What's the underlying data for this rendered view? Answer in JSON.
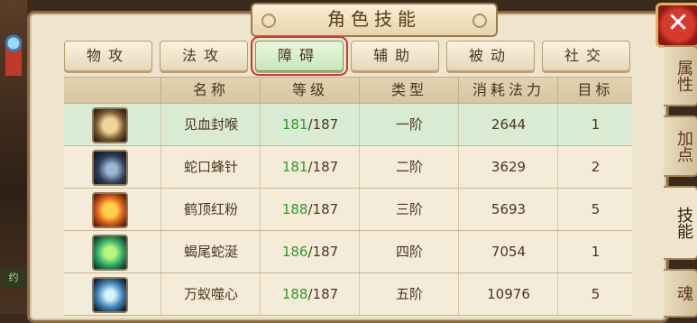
{
  "title": "角色技能",
  "close_symbol": "✕",
  "left_tag": "约",
  "tabs": [
    {
      "label": "物攻"
    },
    {
      "label": "法攻"
    },
    {
      "label": "障碍"
    },
    {
      "label": "辅助"
    },
    {
      "label": "被动"
    },
    {
      "label": "社交"
    }
  ],
  "active_tab": "障碍",
  "table": {
    "headers": [
      "",
      "名称",
      "等级",
      "类型",
      "消耗法力",
      "目标"
    ],
    "rows": [
      {
        "icon": "skill-icon-blood",
        "name": "见血封喉",
        "level_current": "181",
        "level_max": "/187",
        "type": "一阶",
        "mana": "2644",
        "target": "1",
        "selected": true
      },
      {
        "icon": "skill-icon-snake",
        "name": "蛇口蜂针",
        "level_current": "181",
        "level_max": "/187",
        "type": "二阶",
        "mana": "3629",
        "target": "2",
        "selected": false
      },
      {
        "icon": "skill-icon-crane",
        "name": "鹤顶红粉",
        "level_current": "188",
        "level_max": "/187",
        "type": "三阶",
        "mana": "5693",
        "target": "5",
        "selected": false
      },
      {
        "icon": "skill-icon-scorpion",
        "name": "蝎尾蛇涎",
        "level_current": "186",
        "level_max": "/187",
        "type": "四阶",
        "mana": "7054",
        "target": "1",
        "selected": false
      },
      {
        "icon": "skill-icon-ants",
        "name": "万蚁噬心",
        "level_current": "188",
        "level_max": "/187",
        "type": "五阶",
        "mana": "10976",
        "target": "5",
        "selected": false
      }
    ]
  },
  "side_tabs": [
    {
      "label": "属性"
    },
    {
      "label": "加点"
    },
    {
      "label": "技能"
    },
    {
      "label": "魂"
    }
  ],
  "active_side_tab": "技能"
}
